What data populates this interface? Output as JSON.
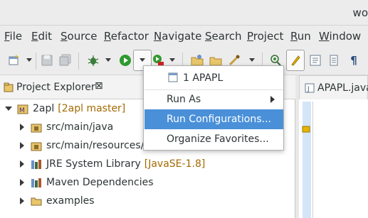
{
  "window": {
    "title": "wo"
  },
  "menubar": [
    "File",
    "Edit",
    "Source",
    "Refactor",
    "Navigate",
    "Search",
    "Project",
    "Run",
    "Window"
  ],
  "toolbar": {
    "icons": [
      "new-wizard-icon",
      "save-icon",
      "save-all-icon",
      "debug-icon",
      "run-icon",
      "coverage-icon",
      "new-java-project-icon",
      "open-type-icon",
      "search-icon",
      "pin-icon",
      "highlight-icon",
      "outline-icon",
      "markers-icon",
      "paragraph-icon"
    ]
  },
  "project_explorer": {
    "title": "Project Explorer",
    "items": [
      {
        "label": "2apl",
        "decoration": "[2apl master]",
        "expanded": true,
        "icon": "maven-project-icon"
      },
      {
        "label": "src/main/java",
        "icon": "source-folder-icon"
      },
      {
        "label": "src/main/resources/license",
        "icon": "source-folder-icon"
      },
      {
        "label": "JRE System Library",
        "decoration": "[JavaSE-1.8]",
        "icon": "library-icon"
      },
      {
        "label": "Maven Dependencies",
        "icon": "library-icon"
      },
      {
        "label": "examples",
        "icon": "folder-icon"
      }
    ]
  },
  "editor": {
    "tab_title": "APAPL.java"
  },
  "run_menu": {
    "items": [
      {
        "label": "1 APAPL",
        "icon": "launch-config-icon"
      },
      {
        "label": "Run As",
        "has_submenu": true
      },
      {
        "label": "Run Configurations...",
        "selected": true
      },
      {
        "label": "Organize Favorites..."
      }
    ]
  },
  "colors": {
    "selection": "#4a90d9",
    "decoration": "#a36a00",
    "run_green": "#2e9a2e",
    "editor_ruler": "#d5e5f8"
  }
}
